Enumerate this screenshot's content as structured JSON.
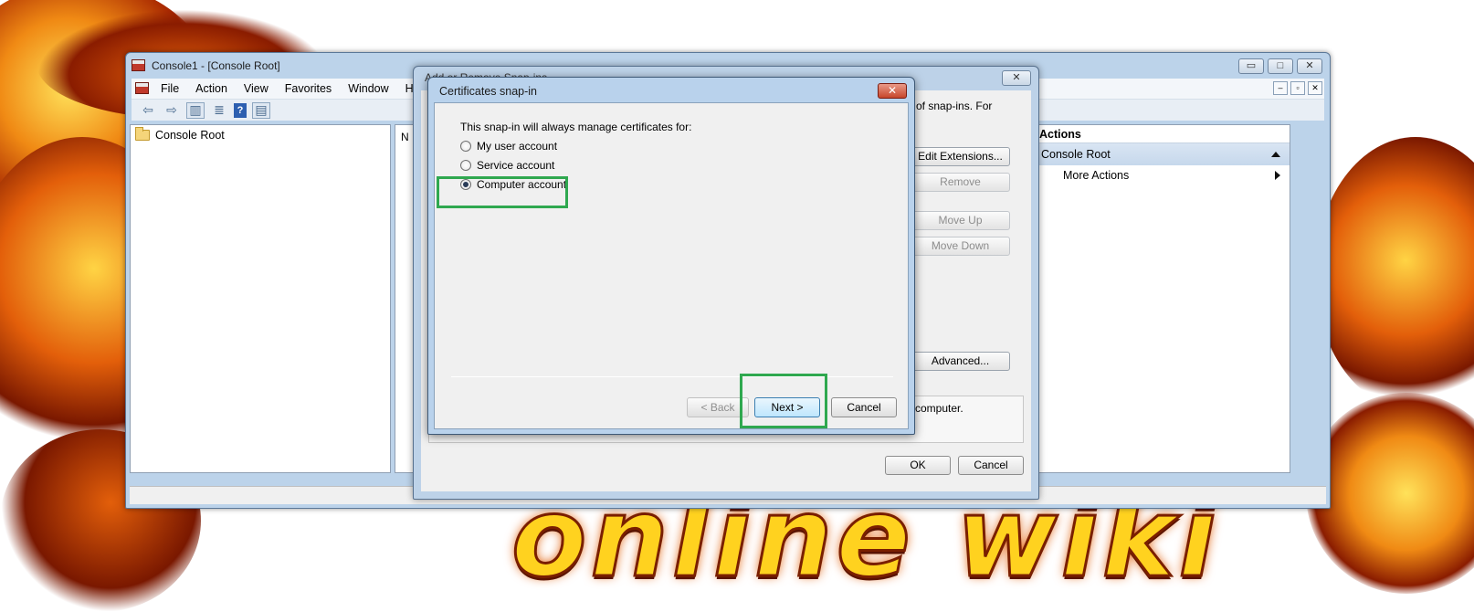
{
  "mmc": {
    "title": "Console1 - [Console Root]",
    "menu": [
      "File",
      "Action",
      "View",
      "Favorites",
      "Window",
      "Help"
    ],
    "window_buttons": [
      "▭",
      "□",
      "✕"
    ],
    "mdi_buttons": [
      "–",
      "▫",
      "✕"
    ],
    "tree_root": "Console Root",
    "center_col": "N",
    "actions": {
      "header": "Actions",
      "section": "Console Root",
      "item": "More Actions"
    }
  },
  "add_remove_dialog": {
    "title": "Add or Remove Snap-ins",
    "close_label": "✕",
    "desc_fragment": "of snap-ins. For",
    "buttons": {
      "edit_extensions": "Edit Extensions...",
      "remove": "Remove",
      "move_up": "Move Up",
      "move_down": "Move Down",
      "advanced": "Advanced..."
    },
    "description_fragment": "a computer.",
    "ok": "OK",
    "cancel": "Cancel"
  },
  "cert_dialog": {
    "title": "Certificates snap-in",
    "close_label": "✕",
    "prompt": "This snap-in will always manage certificates for:",
    "options": [
      {
        "label": "My user account",
        "checked": false
      },
      {
        "label": "Service account",
        "checked": false
      },
      {
        "label": "Computer account",
        "checked": true
      }
    ],
    "back": "< Back",
    "next": "Next >",
    "cancel": "Cancel"
  },
  "background": {
    "word": "online wiki"
  },
  "colors": {
    "highlight": "#2fa84f",
    "title_bar": "#bcd3ea",
    "flame_orange": "#e8620a",
    "flame_yellow": "#ffd21f"
  }
}
